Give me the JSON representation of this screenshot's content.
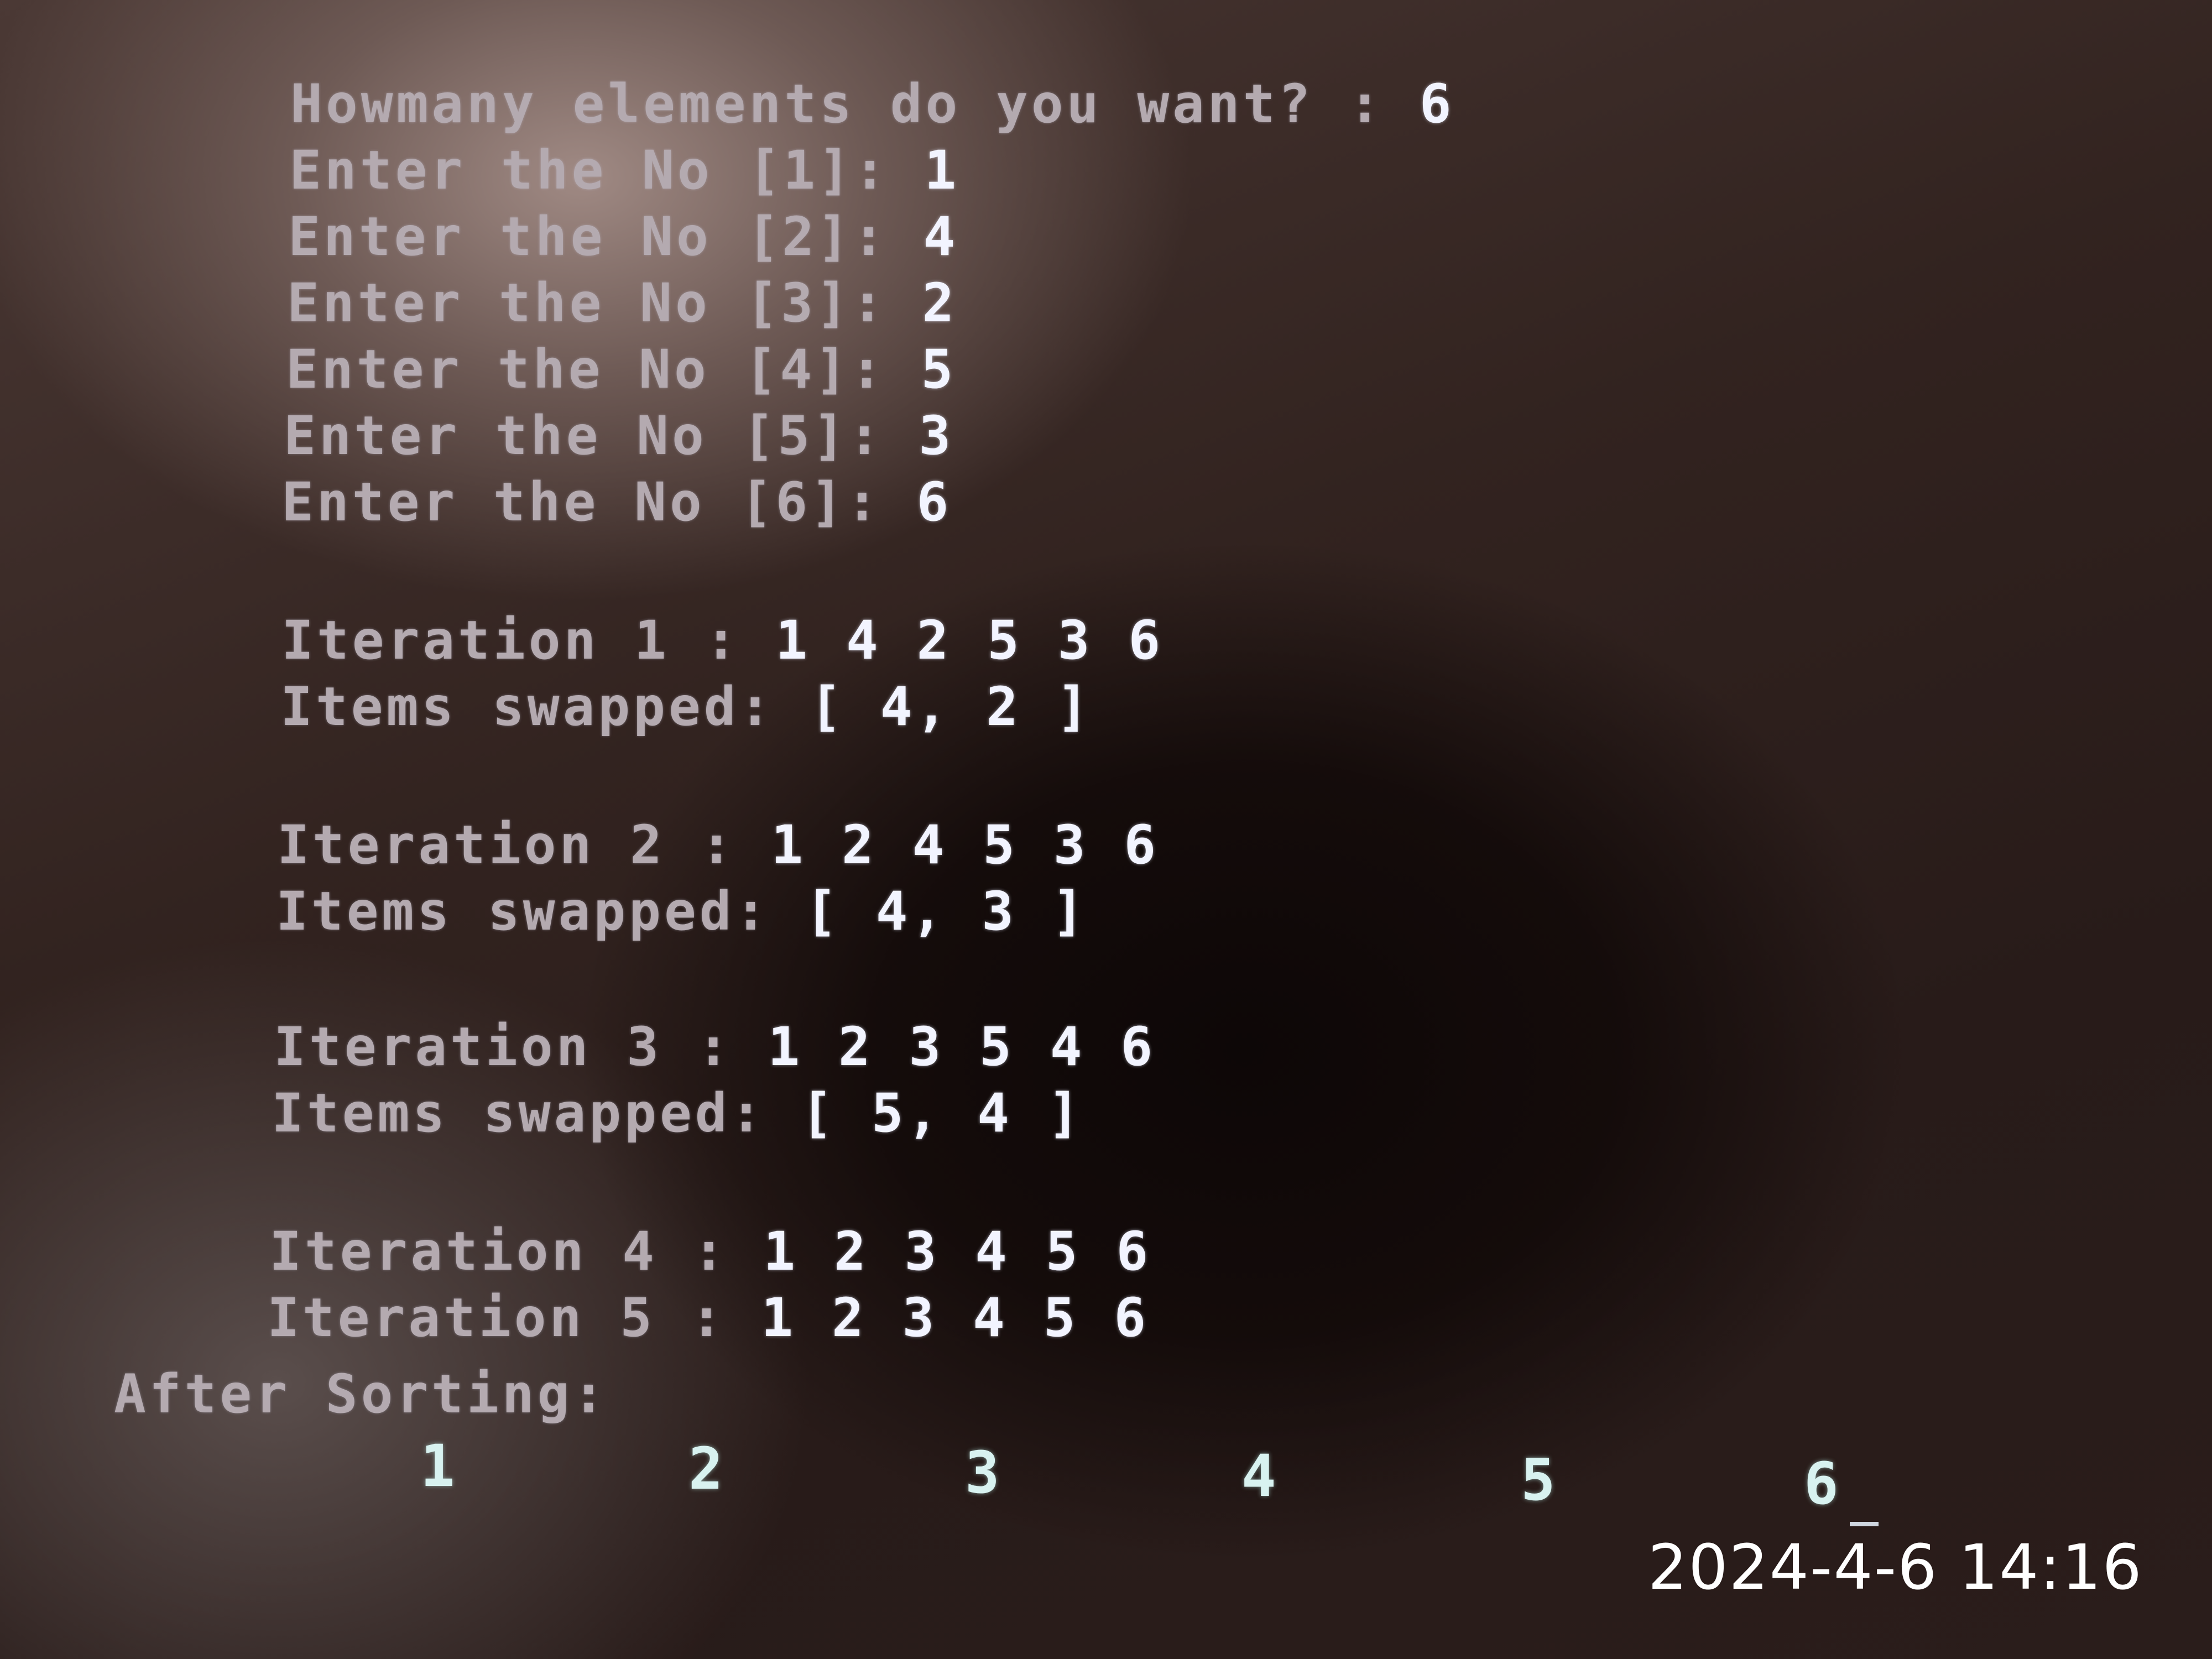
{
  "prompt": {
    "question": "Howmany elements do you want? :",
    "answer": "6"
  },
  "inputs": [
    {
      "label": "Enter the No [1]:",
      "value": "1"
    },
    {
      "label": "Enter the No [2]:",
      "value": "4"
    },
    {
      "label": "Enter the No [3]:",
      "value": "2"
    },
    {
      "label": "Enter the No [4]:",
      "value": "5"
    },
    {
      "label": "Enter the No [5]:",
      "value": "3"
    },
    {
      "label": "Enter the No [6]:",
      "value": "6"
    }
  ],
  "iterations": [
    {
      "label": "Iteration 1 :",
      "values": "1 4 2 5 3 6",
      "swapped_label": "Items swapped:",
      "swapped": "[ 4, 2 ]"
    },
    {
      "label": "Iteration 2 :",
      "values": "1 2 4 5 3 6",
      "swapped_label": "Items swapped:",
      "swapped": "[ 4, 3 ]"
    },
    {
      "label": "Iteration 3 :",
      "values": "1 2 3 5 4 6",
      "swapped_label": "Items swapped:",
      "swapped": "[ 5, 4 ]"
    },
    {
      "label": "Iteration 4 :",
      "values": "1 2 3 4 5 6"
    },
    {
      "label": "Iteration 5 :",
      "values": "1 2 3 4 5 6"
    }
  ],
  "after_sorting": {
    "label": "After Sorting:",
    "values": [
      "1",
      "2",
      "3",
      "4",
      "5",
      "6"
    ]
  },
  "timestamp": "2024-4-6 14:16"
}
